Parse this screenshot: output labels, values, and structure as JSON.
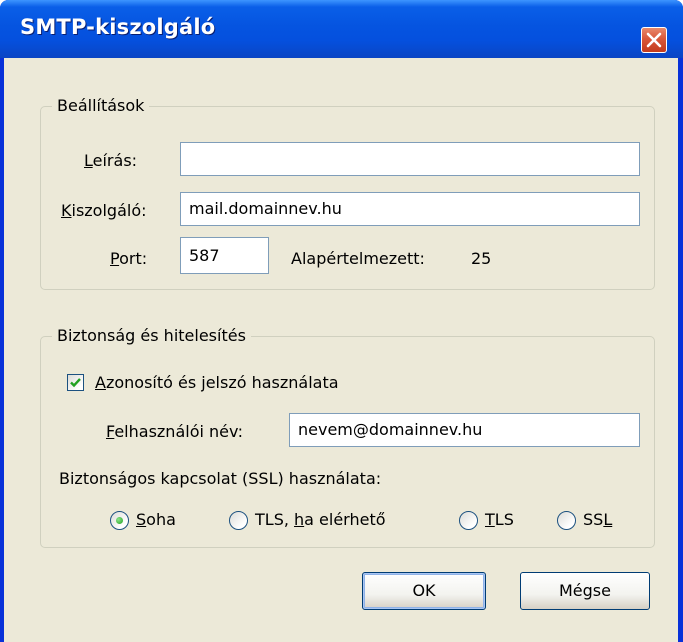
{
  "window": {
    "title": "SMTP-kiszolgáló",
    "close_icon": "close-icon"
  },
  "settings": {
    "legend": "Beállítások",
    "description": {
      "label_mnemonic": "L",
      "label_rest": "eírás:",
      "value": ""
    },
    "server": {
      "label_mnemonic": "K",
      "label_rest": "iszolgáló:",
      "value": "mail.domainnev.hu"
    },
    "port": {
      "label_mnemonic": "P",
      "label_rest": "ort:",
      "value": "587",
      "default_label": "Alapértelmezett:",
      "default_value": "25"
    }
  },
  "security": {
    "legend": "Biztonság és hitelesítés",
    "use_auth": {
      "mnemonic": "A",
      "rest": "zonosító és jelszó használata",
      "checked": true
    },
    "username": {
      "label_mnemonic": "F",
      "label_rest": "elhasználói név:",
      "value": "nevem@domainnev.hu"
    },
    "ssl_label": "Biztonságos kapcsolat (SSL) használata:",
    "ssl_options": [
      {
        "pre": "",
        "mnemonic": "S",
        "post": "oha",
        "selected": true
      },
      {
        "pre": "TLS, ",
        "mnemonic": "h",
        "post": "a elérhető",
        "selected": false
      },
      {
        "pre": "",
        "mnemonic": "T",
        "post": "LS",
        "selected": false
      },
      {
        "pre": "SS",
        "mnemonic": "L",
        "post": "",
        "selected": false
      }
    ]
  },
  "buttons": {
    "ok": "OK",
    "cancel": "Mégse"
  },
  "colors": {
    "titlebar": "#0554e0",
    "dialog_bg": "#ece9d8",
    "close_button": "#d9583a",
    "radio_selected": "#21a121",
    "check": "#21a121"
  }
}
